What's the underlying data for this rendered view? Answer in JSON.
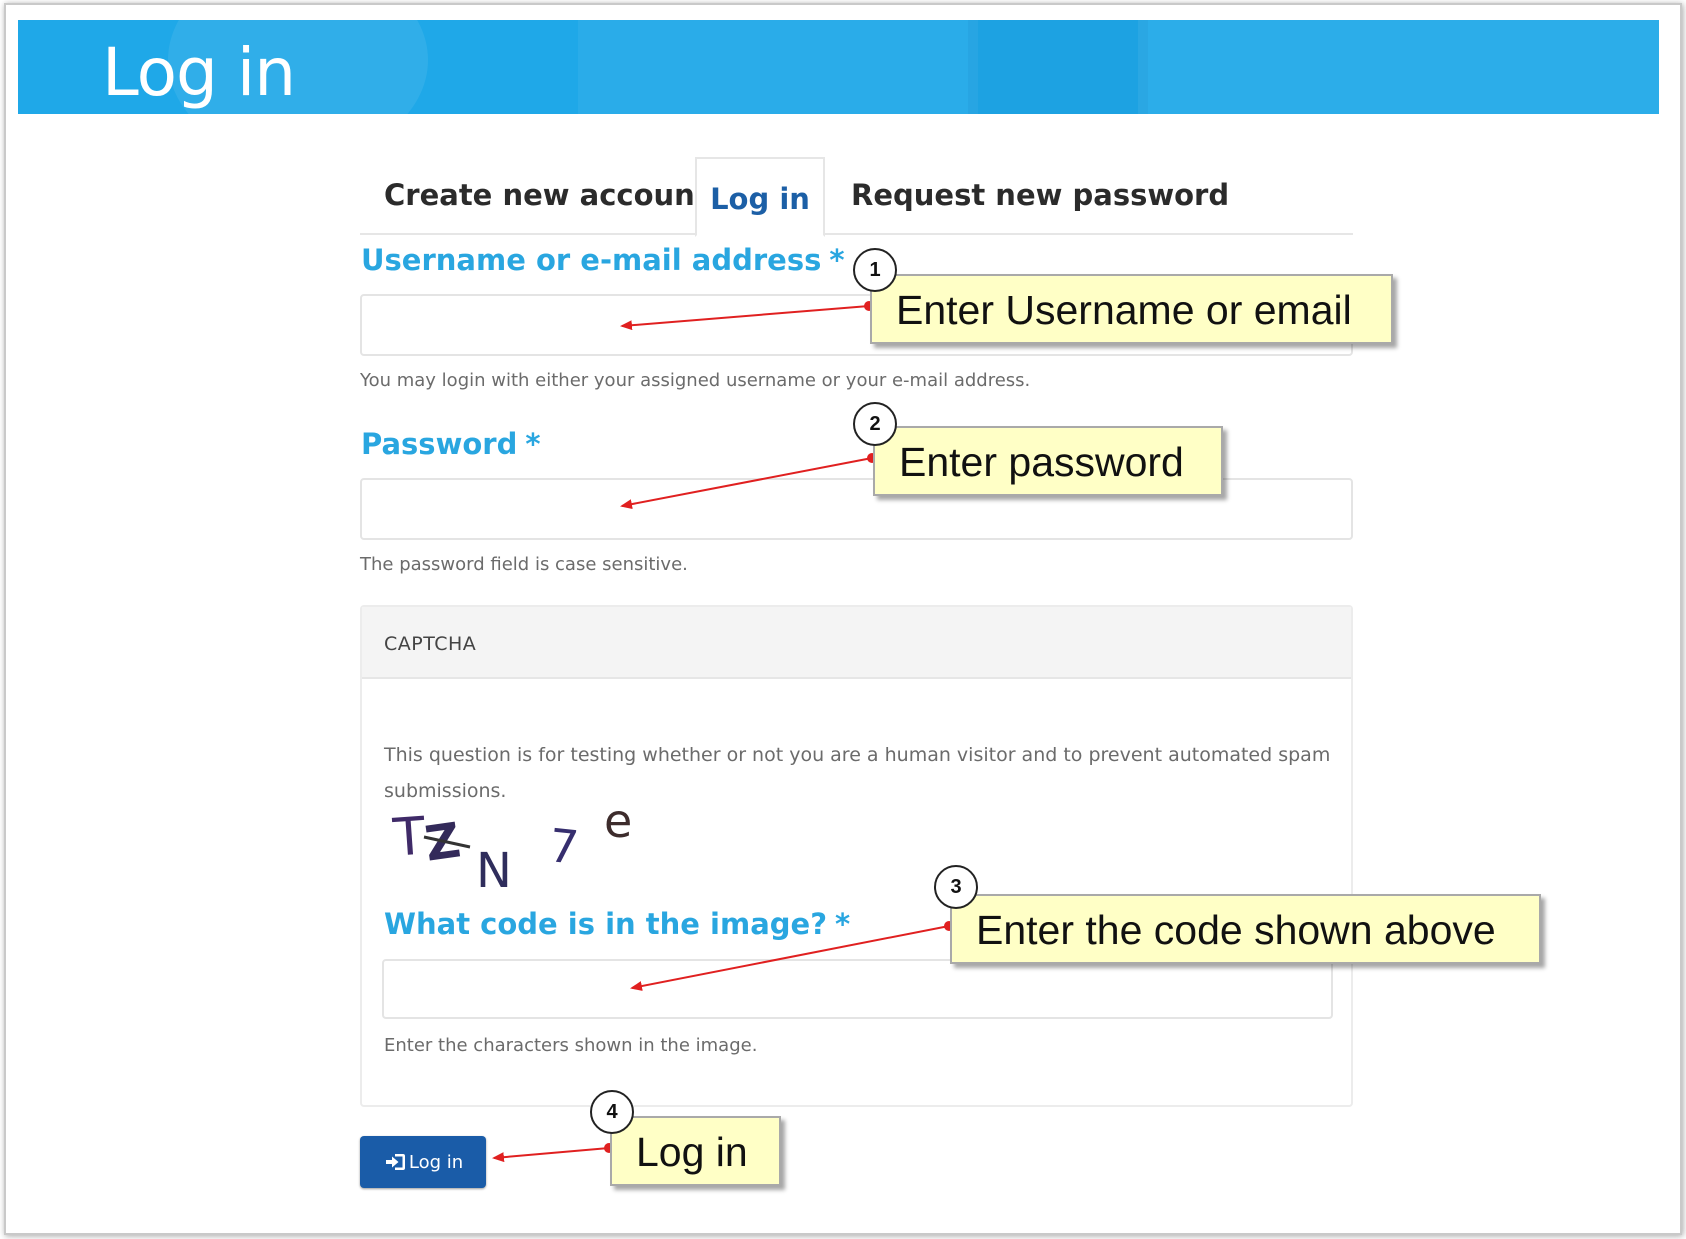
{
  "banner": {
    "title": "Log in"
  },
  "tabs": {
    "create": "Create new account",
    "login": "Log in",
    "request": "Request new password"
  },
  "username": {
    "label": "Username or e-mail address",
    "required_mark": "*",
    "value": "",
    "help": "You may login with either your assigned username or your e-mail address."
  },
  "password": {
    "label": "Password",
    "required_mark": "*",
    "value": "",
    "help": "The password field is case sensitive."
  },
  "captcha": {
    "title": "CAPTCHA",
    "description": "This question is for testing whether or not you are a human visitor and to prevent automated spam submissions.",
    "image_chars": [
      "T",
      "Z",
      "N",
      "7",
      "e"
    ],
    "label": "What code is in the image?",
    "required_mark": "*",
    "value": "",
    "help": "Enter the characters shown in the image."
  },
  "login_button": {
    "label": "Log in",
    "icon": "sign-in-icon"
  },
  "callouts": [
    {
      "number": "1",
      "text": "Enter Username or email"
    },
    {
      "number": "2",
      "text": "Enter password"
    },
    {
      "number": "3",
      "text": "Enter the code shown above"
    },
    {
      "number": "4",
      "text": "Log in"
    }
  ],
  "colors": {
    "banner": "#1fa8e8",
    "label": "#29a6e0",
    "active_tab": "#1c5fa6",
    "button": "#1a5ca8",
    "callout_bg": "#ffffc6",
    "arrow": "#e02020"
  }
}
